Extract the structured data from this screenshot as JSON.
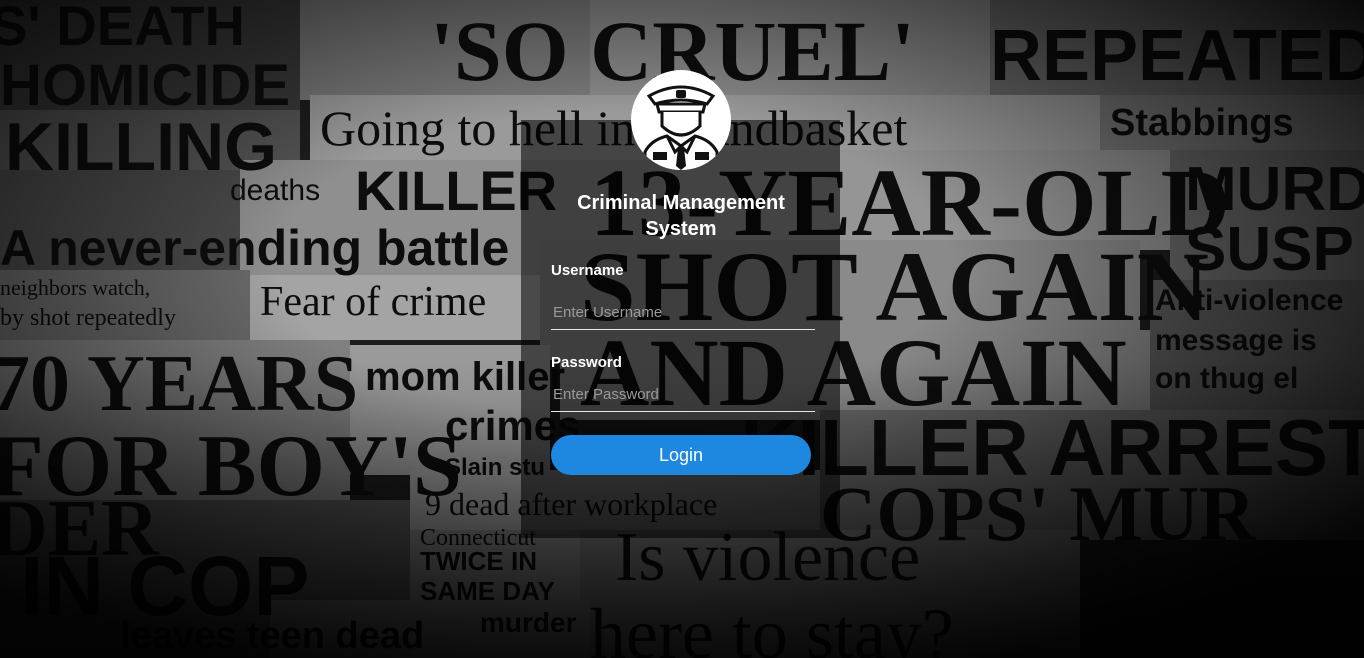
{
  "app": {
    "title": "Criminal Management System",
    "logo_icon": "police-officer-icon"
  },
  "background": {
    "headlines": [
      "'S' DEATH",
      "HOMICIDE",
      "KILLING",
      "deaths",
      "A never-ending battle",
      "neighbors watch,",
      "by shot repeatedly",
      "Fear of crime",
      "70 YEARS",
      "mom killer",
      "crimes",
      "Slain stu",
      "9 dead after workplace",
      "FOR BOY'S",
      "DER",
      "IN COP",
      "TWICE IN",
      "SAME DAY",
      "leaves teen dead",
      "murder",
      "'SO CRUEL'",
      "REPEATED",
      "Going to hell in a handbasket",
      "Stabbings",
      "KILLER",
      "13-YEAR-OLD",
      "MURD",
      "SUSP",
      "SHOT AGAIN",
      "Anti-violence",
      "message is",
      "on thug el",
      "AND AGAIN",
      "KILLER ARRESTED",
      "COPS' MUR",
      "Is violence",
      "here to stay?",
      "Connecticut"
    ]
  },
  "login": {
    "username_label": "Username",
    "username_placeholder": "Enter Username",
    "username_value": "",
    "password_label": "Password",
    "password_placeholder": "Enter Password",
    "password_value": "",
    "login_label": "Login"
  },
  "colors": {
    "accent": "#1e88e0",
    "panel": "rgba(0,0,0,0.55)",
    "text": "#ffffff"
  }
}
